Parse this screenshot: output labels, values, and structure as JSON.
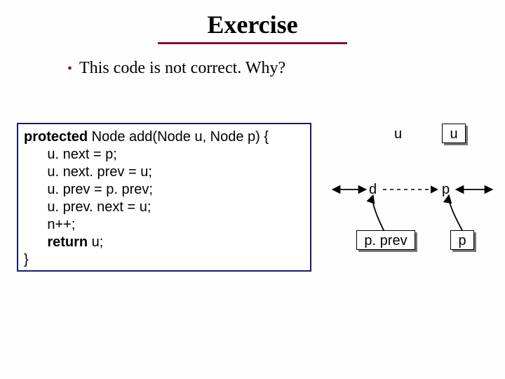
{
  "title": "Exercise",
  "bullet": "This code is not correct. Why?",
  "code": {
    "sig_pre": "protected",
    "sig_rest": " Node add(Node u, Node p) {",
    "l1": "      u. next = p;",
    "l2": "      u. next. prev = u;",
    "l3": "      u. prev = p. prev;",
    "l4": "      u. prev. next = u;",
    "l5": "      n++;",
    "ret_kw": "      return",
    "ret_rest": " u;",
    "end": "}"
  },
  "diagram": {
    "u_left": "u",
    "u_box": "u",
    "d": "d",
    "p_mid": "p",
    "pprev": "p. prev",
    "p_box": "p"
  }
}
